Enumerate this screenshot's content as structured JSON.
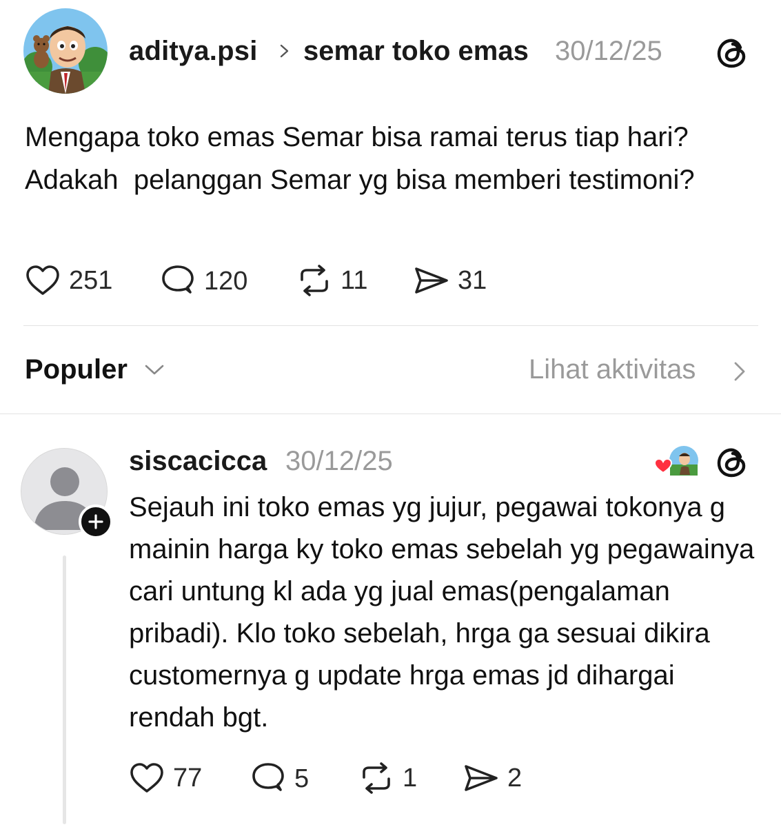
{
  "post": {
    "author": "aditya.psi",
    "topic": "semar toko emas",
    "date": "30/12/25",
    "avatar_icon": "cartoon-man-with-teddy-avatar",
    "text": "Mengapa toko emas Semar bisa ramai terus tiap hari?\nAdakah  pelanggan Semar yg bisa memberi testimoni?",
    "stats": {
      "likes": "251",
      "replies": "120",
      "reposts": "11",
      "shares": "31"
    }
  },
  "sort": {
    "label": "Populer",
    "activity_link": "Lihat aktivitas"
  },
  "reply": {
    "author": "siscacicca",
    "date": "30/12/25",
    "avatar_icon": "default-user-avatar",
    "text": "Sejauh ini toko emas yg jujur, pegawai tokonya g mainin harga ky toko emas sebelah yg pegawainya cari untung kl ada yg jual emas(pengalaman pribadi). Klo toko sebelah, hrga ga sesuai dikira customernya g update hrga emas jd dihargai rendah bgt.",
    "stats": {
      "likes": "77",
      "replies": "5",
      "reposts": "1",
      "shares": "2"
    }
  },
  "colors": {
    "text": "#111111",
    "muted": "#9a9a9a",
    "divider": "#e2e2e2",
    "like_heart": "#ff3040"
  }
}
